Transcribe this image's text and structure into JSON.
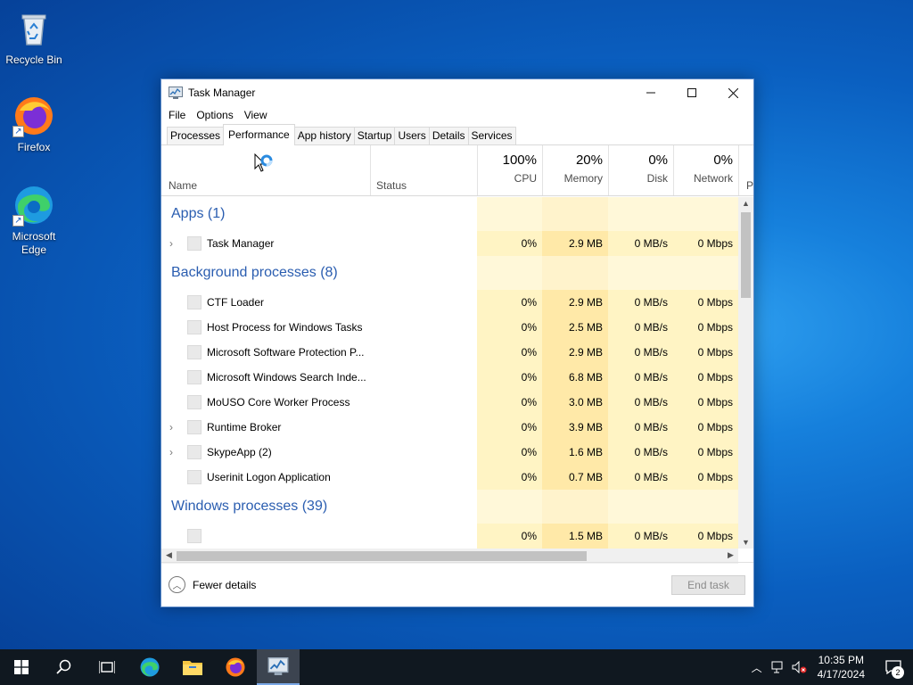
{
  "desktop": {
    "icons": [
      {
        "label": "Recycle Bin",
        "icon": "recycle-bin-icon"
      },
      {
        "label": "Firefox",
        "icon": "firefox-icon"
      },
      {
        "label": "Microsoft Edge",
        "icon": "edge-icon"
      }
    ]
  },
  "window": {
    "title": "Task Manager",
    "menu": [
      "File",
      "Options",
      "View"
    ],
    "tabs": [
      "Processes",
      "Performance",
      "App history",
      "Startup",
      "Users",
      "Details",
      "Services"
    ],
    "active_tab": "Performance"
  },
  "columns": {
    "name": "Name",
    "status": "Status",
    "cpu": {
      "pct": "100%",
      "label": "CPU"
    },
    "memory": {
      "pct": "20%",
      "label": "Memory"
    },
    "disk": {
      "pct": "0%",
      "label": "Disk"
    },
    "network": {
      "pct": "0%",
      "label": "Network"
    },
    "power_partial": "P"
  },
  "groups": {
    "apps": "Apps (1)",
    "background": "Background processes (8)",
    "windows": "Windows processes (39)"
  },
  "rows": {
    "task_manager": {
      "name": "Task Manager",
      "cpu": "0%",
      "mem": "2.9 MB",
      "disk": "0 MB/s",
      "net": "0 Mbps"
    },
    "ctf": {
      "name": "CTF Loader",
      "cpu": "0%",
      "mem": "2.9 MB",
      "disk": "0 MB/s",
      "net": "0 Mbps"
    },
    "host": {
      "name": "Host Process for Windows Tasks",
      "cpu": "0%",
      "mem": "2.5 MB",
      "disk": "0 MB/s",
      "net": "0 Mbps"
    },
    "msp": {
      "name": "Microsoft Software Protection P...",
      "cpu": "0%",
      "mem": "2.9 MB",
      "disk": "0 MB/s",
      "net": "0 Mbps"
    },
    "search": {
      "name": "Microsoft Windows Search Inde...",
      "cpu": "0%",
      "mem": "6.8 MB",
      "disk": "0 MB/s",
      "net": "0 Mbps"
    },
    "mouso": {
      "name": "MoUSO Core Worker Process",
      "cpu": "0%",
      "mem": "3.0 MB",
      "disk": "0 MB/s",
      "net": "0 Mbps"
    },
    "runtime": {
      "name": "Runtime Broker",
      "cpu": "0%",
      "mem": "3.9 MB",
      "disk": "0 MB/s",
      "net": "0 Mbps"
    },
    "skype": {
      "name": "SkypeApp (2)",
      "cpu": "0%",
      "mem": "1.6 MB",
      "disk": "0 MB/s",
      "net": "0 Mbps"
    },
    "userinit": {
      "name": "Userinit Logon Application",
      "cpu": "0%",
      "mem": "0.7 MB",
      "disk": "0 MB/s",
      "net": "0 Mbps"
    },
    "winproc1": {
      "name": "",
      "cpu": "0%",
      "mem": "1.5 MB",
      "disk": "0 MB/s",
      "net": "0 Mbps"
    }
  },
  "footer": {
    "fewer_details": "Fewer details",
    "end_task": "End task"
  },
  "taskbar": {
    "time": "10:35 PM",
    "date": "4/17/2024",
    "notification_count": "2"
  },
  "colors": {
    "group_text": "#2a5db0",
    "cpu_highlight": "#fff4c4",
    "memory_highlight": "#ffe9a8"
  }
}
